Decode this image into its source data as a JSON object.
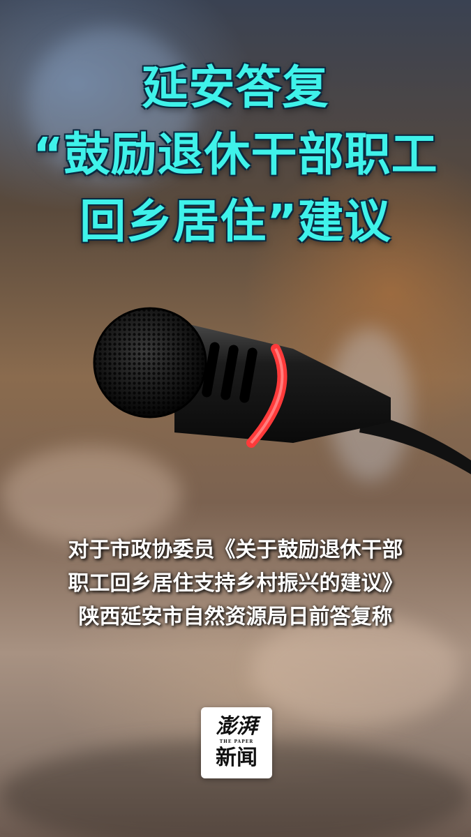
{
  "headline": {
    "line1": "延安答复",
    "line2": "“鼓励退休干部职工",
    "line3": "回乡居住”建议",
    "color": "#3ff2ea"
  },
  "caption": {
    "line1": "对于市政协委员《关于鼓励退休干部",
    "line2": "职工回乡居住支持乡村振兴的建议》",
    "line3": "陕西延安市自然资源局日前答复称"
  },
  "logo": {
    "line1": "澎湃",
    "line2": "THE PAPER",
    "line3": "新闻"
  },
  "microphone": {
    "ring_color": "#ff3a3a"
  }
}
